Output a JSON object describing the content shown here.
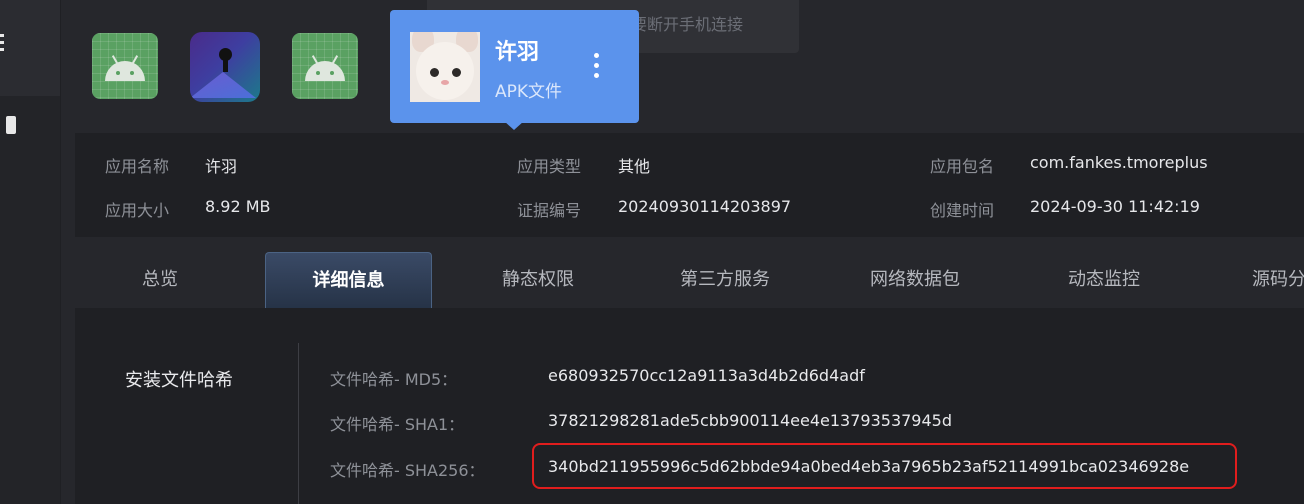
{
  "toast": {
    "text": "开始安装应用，请不要断开手机连接"
  },
  "selected_app": {
    "name": "许羽",
    "type_label": "APK文件"
  },
  "info": {
    "name_label": "应用名称",
    "name_value": "许羽",
    "size_label": "应用大小",
    "size_value": "8.92 MB",
    "type_label": "应用类型",
    "type_value": "其他",
    "evidence_label": "证据编号",
    "evidence_value": "20240930114203897",
    "package_label": "应用包名",
    "package_value": "com.fankes.tmoreplus",
    "created_label": "创建时间",
    "created_value": "2024-09-30 11:42:19"
  },
  "tabs": [
    {
      "label": "总览"
    },
    {
      "label": "详细信息",
      "active": true
    },
    {
      "label": "静态权限"
    },
    {
      "label": "第三方服务"
    },
    {
      "label": "网络数据包"
    },
    {
      "label": "动态监控"
    },
    {
      "label": "源码分"
    }
  ],
  "detail": {
    "section_title": "安装文件哈希",
    "rows": [
      {
        "label": "文件哈希- MD5：",
        "value": "e680932570cc12a9113a3d4b2d6d4adf"
      },
      {
        "label": "文件哈希- SHA1：",
        "value": "37821298281ade5cbb900114ee4e13793537945d"
      },
      {
        "label": "文件哈希- SHA256：",
        "value": "340bd211955996c5d62bbde94a0bed4eb3a7965b23af52114991bca02346928e",
        "highlighted": true
      }
    ]
  },
  "colors": {
    "accent": "#5b93ec",
    "highlight_border": "#e01d1d",
    "background": "#26272c",
    "panel": "#1f2024"
  }
}
